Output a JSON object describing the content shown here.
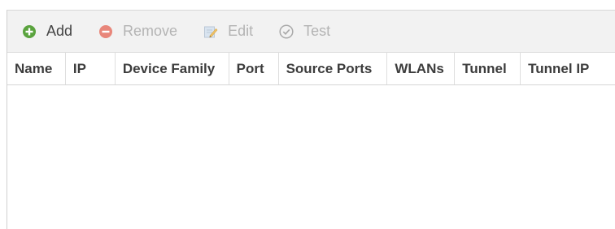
{
  "toolbar": {
    "add_label": "Add",
    "remove_label": "Remove",
    "edit_label": "Edit",
    "test_label": "Test",
    "icons": {
      "add": "add-circle-icon",
      "remove": "remove-circle-icon",
      "edit": "edit-pencil-icon",
      "test": "check-circle-icon"
    },
    "colors": {
      "add_icon": "#5aa33e",
      "remove_icon": "#e8867a",
      "enabled_text": "#444444",
      "disabled_text": "#b4b4b4"
    }
  },
  "grid": {
    "columns": [
      "Name",
      "IP",
      "Device Family",
      "Port",
      "Source Ports",
      "WLANs",
      "Tunnel",
      "Tunnel IP"
    ],
    "rows": []
  }
}
